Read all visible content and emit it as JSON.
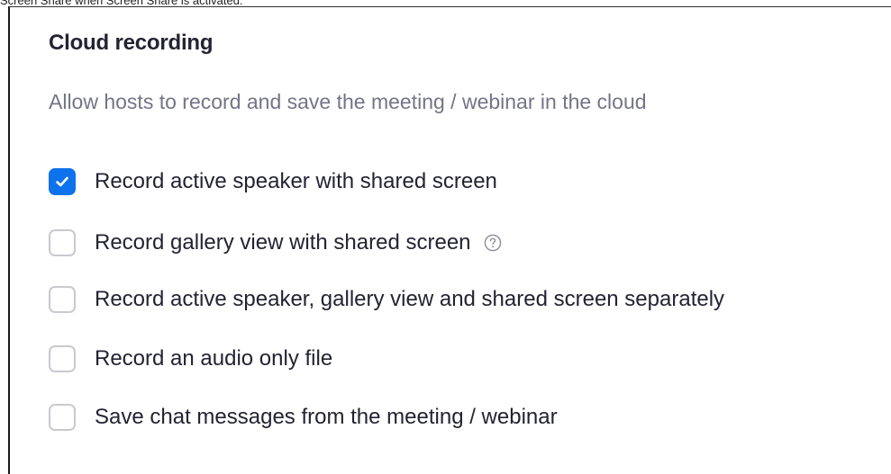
{
  "caption": {
    "text": "Screen Share when Screen Share is activated."
  },
  "section": {
    "title": "Cloud recording",
    "description": "Allow hosts to record and save the meeting / webinar in the cloud"
  },
  "options": [
    {
      "label": "Record active speaker with shared screen",
      "checked": true
    },
    {
      "label": "Record gallery view with shared screen",
      "checked": false,
      "icon": "help-icon"
    },
    {
      "label": "Record active speaker, gallery view and shared screen separately",
      "checked": false
    },
    {
      "label": "Record an audio only file",
      "checked": false
    },
    {
      "label": "Save chat messages from the meeting / webinar",
      "checked": false
    }
  ],
  "colors": {
    "accent": "#0e72ed",
    "text": "#232333",
    "muted": "#747487",
    "checkbox_border": "#c9c9d1"
  }
}
